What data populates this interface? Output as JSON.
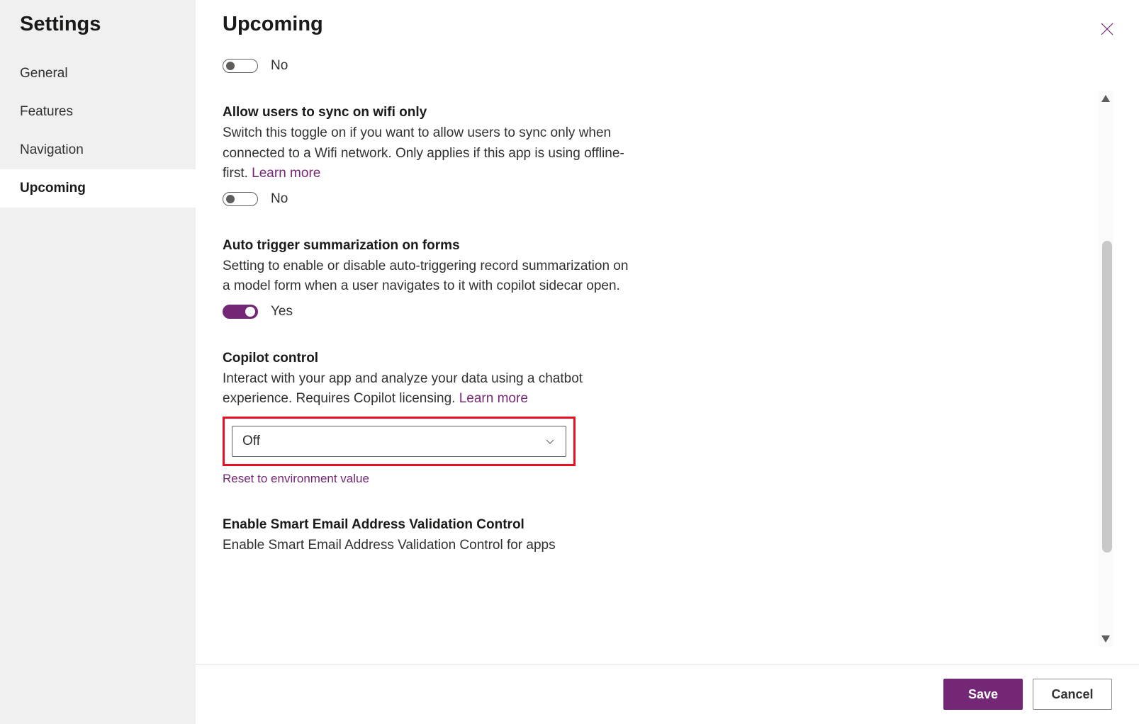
{
  "sidebar": {
    "title": "Settings",
    "items": [
      {
        "label": "General"
      },
      {
        "label": "Features"
      },
      {
        "label": "Navigation"
      },
      {
        "label": "Upcoming"
      }
    ],
    "active_index": 3
  },
  "header": {
    "title": "Upcoming"
  },
  "settings": {
    "item0": {
      "toggle_label": "No",
      "toggle_on": false
    },
    "wifi_sync": {
      "title": "Allow users to sync on wifi only",
      "desc_pre": "Switch this toggle on if you want to allow users to sync only when connected to a Wifi network. Only applies if this app is using offline-first. ",
      "learn_more": "Learn more",
      "toggle_label": "No",
      "toggle_on": false
    },
    "auto_summarize": {
      "title": "Auto trigger summarization on forms",
      "desc": "Setting to enable or disable auto-triggering record summarization on a model form when a user navigates to it with copilot sidecar open.",
      "toggle_label": "Yes",
      "toggle_on": true
    },
    "copilot": {
      "title": "Copilot control",
      "desc_pre": "Interact with your app and analyze your data using a chatbot experience. Requires Copilot licensing. ",
      "learn_more": "Learn more",
      "selected": "Off",
      "reset_label": "Reset to environment value"
    },
    "smart_email": {
      "title": "Enable Smart Email Address Validation Control",
      "desc": "Enable Smart Email Address Validation Control for apps"
    }
  },
  "footer": {
    "save": "Save",
    "cancel": "Cancel"
  }
}
